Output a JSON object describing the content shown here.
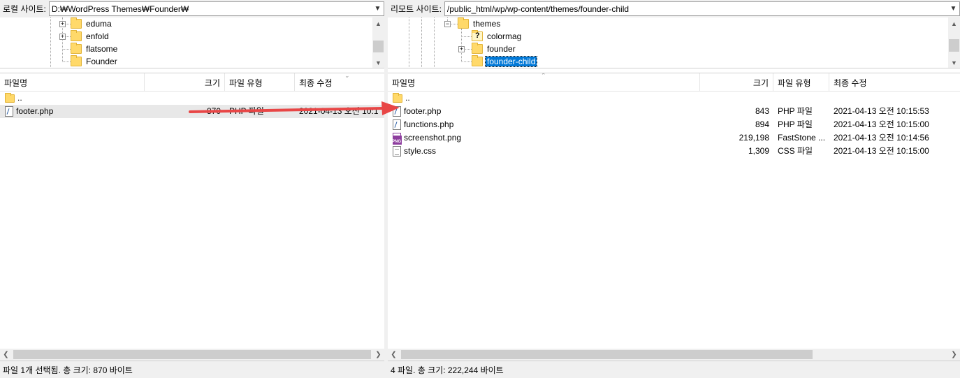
{
  "local": {
    "site_label": "로컬 사이트:",
    "path": "D:₩WordPress Themes₩Founder₩",
    "tree": [
      "eduma",
      "enfold",
      "flatsome",
      "Founder"
    ],
    "columns": {
      "name": "파일명",
      "size": "크기",
      "type": "파일 유형",
      "modified": "최종 수정"
    },
    "rows": [
      {
        "name": "..",
        "kind": "folder"
      },
      {
        "name": "footer.php",
        "size": "870",
        "type": "PHP 파일",
        "modified": "2021-04-13 오전 10:1",
        "kind": "php",
        "selected": true
      }
    ],
    "status": "파일 1개 선택됨. 총 크기: 870 바이트"
  },
  "remote": {
    "site_label": "리모트 사이트:",
    "path": "/public_html/wp/wp-content/themes/founder-child",
    "tree": [
      "themes",
      "colormag",
      "founder",
      "founder-child"
    ],
    "columns": {
      "name": "파일명",
      "size": "크기",
      "type": "파일 유형",
      "modified": "최종 수정"
    },
    "rows": [
      {
        "name": "..",
        "kind": "folder"
      },
      {
        "name": "footer.php",
        "size": "843",
        "type": "PHP 파일",
        "modified": "2021-04-13 오전 10:15:53",
        "kind": "php"
      },
      {
        "name": "functions.php",
        "size": "894",
        "type": "PHP 파일",
        "modified": "2021-04-13 오전 10:15:00",
        "kind": "php"
      },
      {
        "name": "screenshot.png",
        "size": "219,198",
        "type": "FastStone ...",
        "modified": "2021-04-13 오전 10:14:56",
        "kind": "png"
      },
      {
        "name": "style.css",
        "size": "1,309",
        "type": "CSS 파일",
        "modified": "2021-04-13 오전 10:15:00",
        "kind": "css"
      }
    ],
    "status": "4 파일. 총 크기: 222,244 바이트"
  },
  "colors": {
    "selection": "#0078d7",
    "annotation_arrow": "#e84646"
  },
  "icons": {
    "folder": "folder-icon",
    "php": "php-file-icon",
    "png": "png-file-icon",
    "css": "css-file-icon"
  }
}
